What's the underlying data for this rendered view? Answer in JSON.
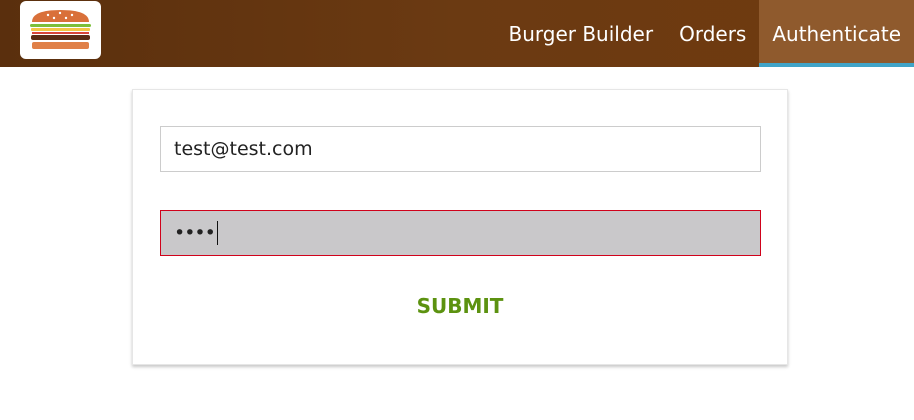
{
  "toolbar": {
    "logo_icon": "burger-icon",
    "nav": [
      {
        "label": "Burger Builder"
      },
      {
        "label": "Orders"
      },
      {
        "label": "Authenticate",
        "active": true
      }
    ]
  },
  "auth_form": {
    "email_value": "test@test.com",
    "password_value": "••••",
    "submit_label": "SUBMIT"
  },
  "colors": {
    "toolbar_brown": "#703b0f",
    "active_nav_bg": "#8f5a2d",
    "active_nav_underline": "#40a4c8",
    "invalid_border": "#d0021b",
    "submit_green": "#5c9210"
  }
}
